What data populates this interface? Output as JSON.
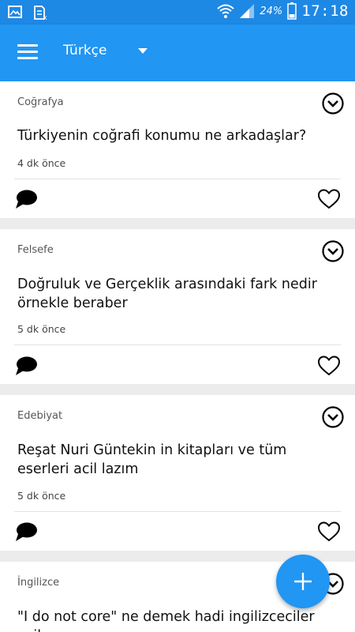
{
  "status_bar": {
    "battery_percent": "24%",
    "time": "17:18",
    "icons": [
      "gallery-icon",
      "sim-card-icon",
      "wifi-icon",
      "signal-icon",
      "battery-icon"
    ]
  },
  "app_bar": {
    "language": "Türkçe",
    "menu_icon": "hamburger-menu-icon",
    "dropdown_icon": "caret-down-icon"
  },
  "questions": [
    {
      "category": "Coğrafya",
      "text": "Türkiyenin coğrafi konumu ne arkadaşlar?",
      "time": "4 dk önce"
    },
    {
      "category": "Felsefe",
      "text": "Doğruluk ve Gerçeklik arasındaki fark nedir örnekle beraber",
      "time": "5 dk önce"
    },
    {
      "category": "Edebiyat",
      "text": "Reşat Nuri Güntekin in kitapları ve tüm eserleri acil lazım",
      "time": "5 dk önce"
    },
    {
      "category": "İngilizce",
      "text": "\"I do not core\" ne demek hadi ingilizceciler acil",
      "time": ""
    }
  ],
  "fab": {
    "icon": "plus-icon"
  },
  "colors": {
    "primary": "#2196f3",
    "status_bar": "#1e88e5",
    "background": "#ececec"
  }
}
